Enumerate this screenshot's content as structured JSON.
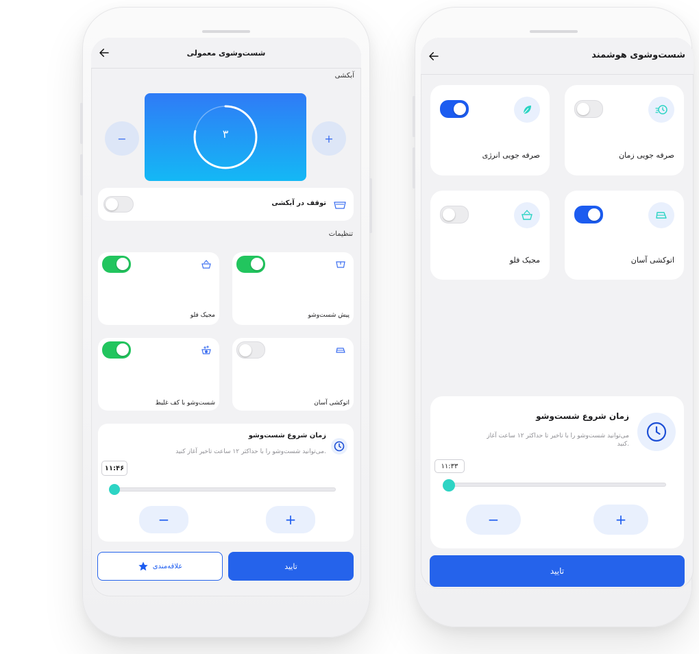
{
  "left_screen": {
    "title": "شست‌وشوی معمولی",
    "rinse_label": "آبکشی",
    "rinse_count": "۳",
    "rinse_progress": 0.78,
    "minus_label": "−",
    "plus_label": "+",
    "pause_rinse_label": "توقف در آبکشی",
    "pause_rinse_on": false,
    "settings_label": "تنظیمات",
    "options": [
      {
        "label": "پیش شست‌وشو",
        "icon": "prewash-icon",
        "on": true
      },
      {
        "label": "مجیک فلو",
        "icon": "magic-flow-icon",
        "on": true
      },
      {
        "label": "اتوکشی آسان",
        "icon": "iron-icon",
        "on": false
      },
      {
        "label": "شست‌وشو با کف غلیظ",
        "icon": "foam-wash-icon",
        "on": true
      }
    ],
    "start_time": {
      "title": "زمان شروع شست‌وشو",
      "description": "می‌توانید شست‌وشو را با حداکثر ۱۲ ساعت تاخیر آغاز کنید.",
      "value": "۱۱:۴۶",
      "slider_position": 0.0,
      "minus_label": "−",
      "plus_label": "+"
    },
    "confirm_label": "تایید",
    "favorite_label": "علاقه‌مندی",
    "accent_color": "#2563eb",
    "toggle_on_color": "#22c55e"
  },
  "right_screen": {
    "title": "شست‌وشوی هوشمند",
    "options": [
      {
        "label": "صرفه جویی زمان",
        "icon": "time-save-icon",
        "on": false
      },
      {
        "label": "صرفه جویی انرژی",
        "icon": "leaf-icon",
        "on": true
      },
      {
        "label": "اتوکشی آسان",
        "icon": "iron-icon",
        "on": true
      },
      {
        "label": "مجیک فلو",
        "icon": "magic-flow-icon",
        "on": false
      }
    ],
    "start_time": {
      "title": "زمان شروع شست‌وشو",
      "description": "می‌توانید شست‌وشو را با تاخیر تا حداکثر ۱۲ ساعت آغاز کنید.",
      "value": "۱۱:۳۳",
      "slider_position": 0.0,
      "minus_label": "−",
      "plus_label": "+"
    },
    "confirm_label": "تایید",
    "toggle_on_color": "#1c5cf0"
  }
}
